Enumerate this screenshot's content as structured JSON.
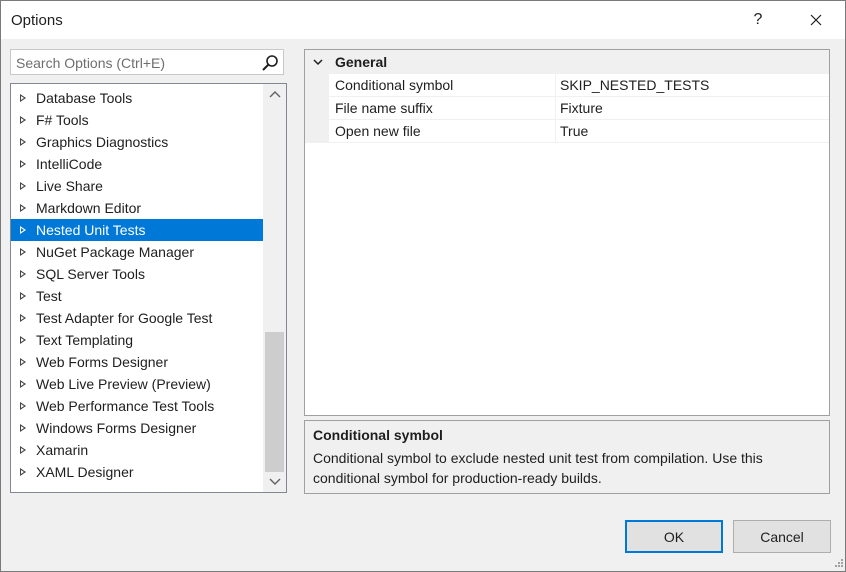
{
  "window": {
    "title": "Options",
    "help": "?"
  },
  "search": {
    "placeholder": "Search Options (Ctrl+E)"
  },
  "tree": {
    "items": [
      "Database Tools",
      "F# Tools",
      "Graphics Diagnostics",
      "IntelliCode",
      "Live Share",
      "Markdown Editor",
      "Nested Unit Tests",
      "NuGet Package Manager",
      "SQL Server Tools",
      "Test",
      "Test Adapter for Google Test",
      "Text Templating",
      "Web Forms Designer",
      "Web Live Preview (Preview)",
      "Web Performance Test Tools",
      "Windows Forms Designer",
      "Xamarin",
      "XAML Designer"
    ],
    "selected": "Nested Unit Tests"
  },
  "grid": {
    "category": "General",
    "properties": [
      {
        "name": "Conditional symbol",
        "value": "SKIP_NESTED_TESTS"
      },
      {
        "name": "File name suffix",
        "value": "Fixture"
      },
      {
        "name": "Open new file",
        "value": "True"
      }
    ]
  },
  "description": {
    "title": "Conditional symbol",
    "text": "Conditional symbol to exclude nested unit test from compilation. Use this conditional symbol for production-ready builds."
  },
  "buttons": {
    "ok": "OK",
    "cancel": "Cancel"
  },
  "colors": {
    "accent": "#0078d7",
    "window_bg": "#f0f0f0"
  }
}
